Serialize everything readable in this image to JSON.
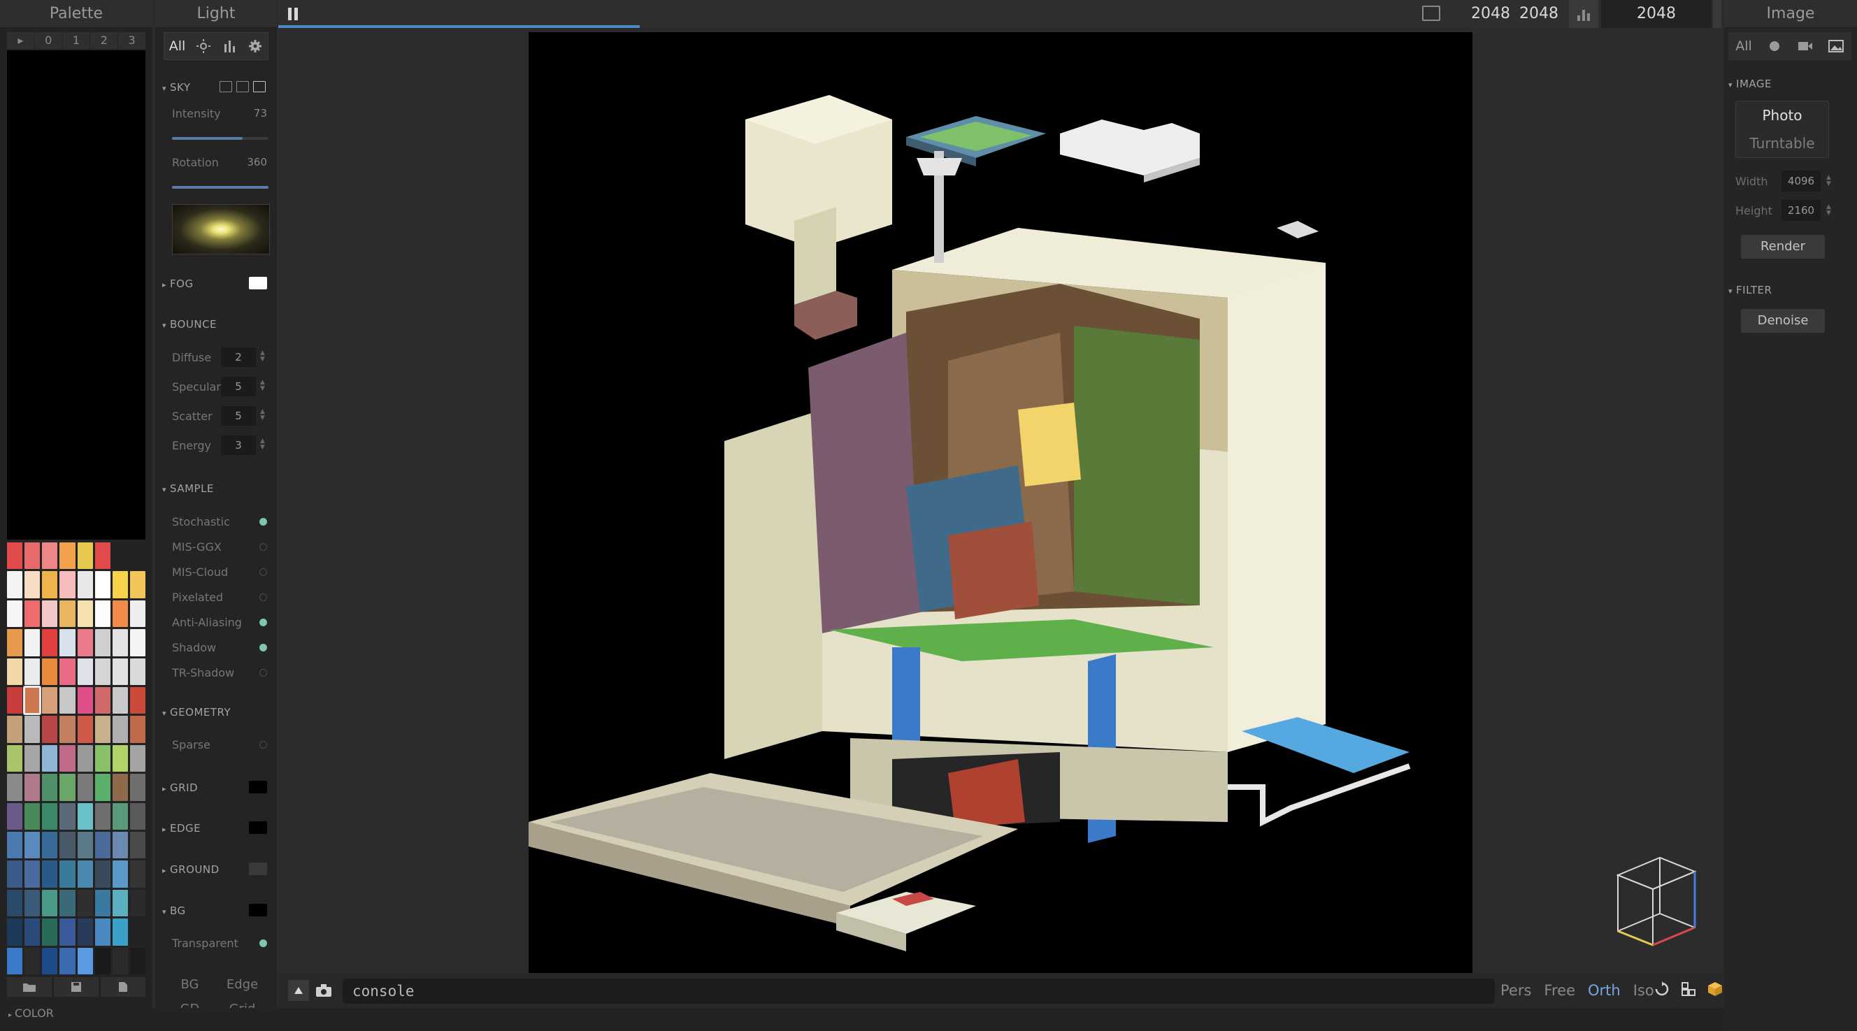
{
  "palette": {
    "title": "Palette",
    "tabs": [
      "▸",
      "0",
      "1",
      "2",
      "3"
    ],
    "swatches": [
      "#e24b4b",
      "#e96a6a",
      "#ee8686",
      "#f2a24c",
      "#e6c94e",
      "#e24b4b",
      "",
      "",
      "#f3f3f3",
      "#f5dcc2",
      "#f0b24a",
      "#f6bcbc",
      "#e8e8e8",
      "#ffffff",
      "#f7d34a",
      "#f2c55a",
      "#f5f5f5",
      "#ef6c6c",
      "#f2c7c7",
      "#e9b55f",
      "#f6e0b0",
      "#fbfbfb",
      "#f08b4a",
      "#eeeeee",
      "#e59b4b",
      "#f2f2f2",
      "#e04040",
      "#d7e2ec",
      "#eb7b8b",
      "#cfcfcf",
      "#e3e3e3",
      "#f4f4f4",
      "#f1d8a9",
      "#ececec",
      "#e78a3c",
      "#e86c86",
      "#dfe3e9",
      "#d5d5d5",
      "#e2e2e2",
      "#dadada",
      "#c83c3c",
      "#cd7750",
      "#d8a07a",
      "#c7c7c7",
      "#e04e8a",
      "#d06a6a",
      "#c9c9c9",
      "#cc4a3a",
      "#c4a07a",
      "#b9b9b9",
      "#b84646",
      "#c28060",
      "#cf5a4a",
      "#c7b18a",
      "#b0b0b0",
      "#bf6a4a",
      "#a9c56b",
      "#a6a6a6",
      "#8fb6d4",
      "#c06a8a",
      "#9a9a9a",
      "#8ac06a",
      "#b0d46a",
      "#a4a4a4",
      "#8a8a8a",
      "#b07a8a",
      "#4f8f6a",
      "#6aa66a",
      "#7a7a7a",
      "#5ab06a",
      "#8f6a4a",
      "#6e6e6e",
      "#6a5a8a",
      "#4a8a5a",
      "#3a8a6a",
      "#5a6a7a",
      "#6ac0c8",
      "#6e6e6e",
      "#5a9a7a",
      "#5a5a5a",
      "#4a7ab0",
      "#5a8ac0",
      "#3a6a9a",
      "#4a5a6a",
      "#5a7a8a",
      "#4a6a9a",
      "#6a8ab0",
      "#4a4a4a",
      "#3a5a8a",
      "#4a6aa0",
      "#2a5a8a",
      "#3a7a9a",
      "#4a8ab0",
      "#3a4a5a",
      "#5a9ac8",
      "#353535",
      "#2a4a6a",
      "#3a5a7a",
      "#4a9a8a",
      "#3a6a7a",
      "#2f2f2f",
      "#3a7aa0",
      "#5ab0c0",
      "#2a2a2a",
      "#1e3a5a",
      "#2a4a7a",
      "#2a6a5a",
      "#3a5a9a",
      "#2a3a5a",
      "#4a8ac0",
      "#3aa0c8",
      "#222222",
      "#3a7ac8",
      "#2a2a2a",
      "#1f4a8a",
      "#3a6ab0",
      "#5a9ae0",
      "#1a1a1a",
      "#2a2a2a",
      "#1c1c1c"
    ],
    "selected_index": 41,
    "color_section": "COLOR"
  },
  "light": {
    "title": "Light",
    "filter": [
      "All"
    ],
    "sky": {
      "label": "SKY",
      "intensity_label": "Intensity",
      "intensity_value": "73",
      "intensity_fraction": 0.73,
      "rotation_label": "Rotation",
      "rotation_value": "360",
      "rotation_fraction": 1.0
    },
    "fog": {
      "label": "FOG",
      "color": "#ffffff"
    },
    "bounce": {
      "label": "BOUNCE",
      "rows": [
        {
          "label": "Diffuse",
          "value": "2"
        },
        {
          "label": "Specular",
          "value": "5"
        },
        {
          "label": "Scatter",
          "value": "5"
        },
        {
          "label": "Energy",
          "value": "3"
        }
      ]
    },
    "sample": {
      "label": "SAMPLE",
      "rows": [
        {
          "label": "Stochastic",
          "on": true
        },
        {
          "label": "MIS-GGX",
          "on": false
        },
        {
          "label": "MIS-Cloud",
          "on": false
        },
        {
          "label": "Pixelated",
          "on": false
        },
        {
          "label": "Anti-Aliasing",
          "on": true
        },
        {
          "label": "Shadow",
          "on": true
        },
        {
          "label": "TR-Shadow",
          "on": false
        }
      ]
    },
    "geometry": {
      "label": "GEOMETRY",
      "sparse_label": "Sparse",
      "sparse_on": false
    },
    "grid": {
      "label": "GRID",
      "color": "#000000"
    },
    "edge": {
      "label": "EDGE",
      "color": "#000000"
    },
    "ground": {
      "label": "GROUND",
      "color": "#3a3a3a"
    },
    "bg": {
      "label": "BG",
      "color": "#000000",
      "transparent_label": "Transparent",
      "transparent_on": true
    },
    "footer": [
      "BG",
      "Edge",
      "GD",
      "Grid"
    ]
  },
  "topbar": {
    "width": "2048",
    "height": "2048",
    "size": "2048",
    "progress_fraction": 0.25
  },
  "bottombar": {
    "console_text": "console",
    "views": [
      "Pers",
      "Free",
      "Orth",
      "Iso"
    ],
    "active_view": "Orth"
  },
  "image": {
    "title": "Image",
    "filter_all": "All",
    "section_image": "IMAGE",
    "modes": [
      "Photo",
      "Turntable"
    ],
    "active_mode": "Photo",
    "width_label": "Width",
    "width_value": "4096",
    "height_label": "Height",
    "height_value": "2160",
    "render_label": "Render",
    "section_filter": "FILTER",
    "denoise_label": "Denoise"
  },
  "colors": {
    "accent": "#4f87c8",
    "toggle_on": "#7ec6ad",
    "active_view": "#7aa6e0"
  }
}
